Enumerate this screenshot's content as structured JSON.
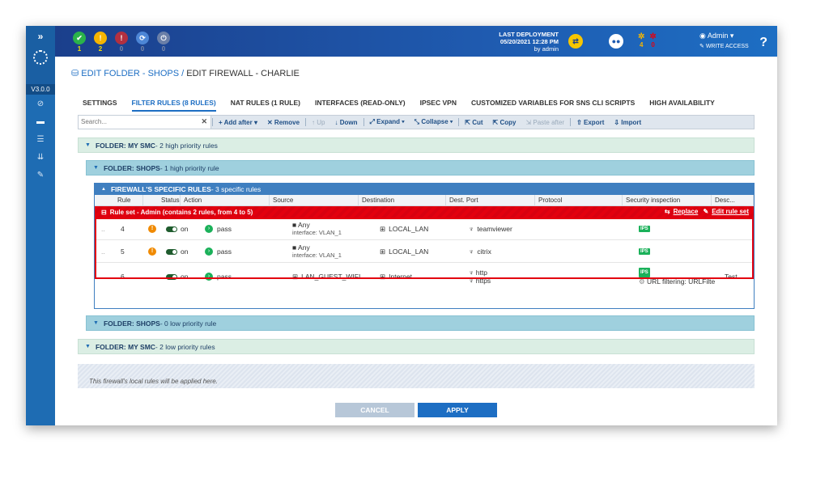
{
  "sidebar": {
    "version": "V3.0.0",
    "expand": "»"
  },
  "header": {
    "status": [
      {
        "icon": "check-icon",
        "count": "1",
        "color": "#2bb34a",
        "count_color": "#f7e000",
        "glyph": "✔"
      },
      {
        "icon": "warning-icon",
        "count": "2",
        "color": "#f7b500",
        "count_color": "#f7e000",
        "glyph": "!"
      },
      {
        "icon": "error-icon",
        "count": "0",
        "color": "#b33040",
        "count_color": "#7d8aa8",
        "glyph": "!"
      },
      {
        "icon": "sync-icon",
        "count": "0",
        "color": "#4d86d6",
        "count_color": "#7d8aa8",
        "glyph": "⟳"
      },
      {
        "icon": "power-icon",
        "count": "0",
        "color": "#6a7fa8",
        "count_color": "#7d8aa8",
        "glyph": "⏻"
      }
    ],
    "deployment": {
      "label": "LAST DEPLOYMENT",
      "date": "05/20/2021 12:28 PM",
      "by": "by admin"
    },
    "alerts": [
      {
        "icon": "maintenance-icon",
        "count": "4",
        "color": "#f7b500"
      },
      {
        "icon": "alarm-icon",
        "count": "0",
        "color": "#e3000f"
      }
    ],
    "admin": {
      "name": "Admin",
      "access": "WRITE ACCESS"
    },
    "help": "?"
  },
  "breadcrumb": {
    "path": "EDIT FOLDER - SHOPS /",
    "current": "EDIT FIREWALL - CHARLIE"
  },
  "tabs": [
    "SETTINGS",
    "FILTER RULES (8 RULES)",
    "NAT RULES (1 RULE)",
    "INTERFACES (READ-ONLY)",
    "IPSEC VPN",
    "CUSTOMIZED VARIABLES FOR SNS CLI SCRIPTS",
    "HIGH AVAILABILITY"
  ],
  "toolbar": {
    "search_placeholder": "Search...",
    "add_after": "Add after",
    "remove": "Remove",
    "up": "Up",
    "down": "Down",
    "expand": "Expand",
    "collapse": "Collapse",
    "cut": "Cut",
    "copy": "Copy",
    "paste_after": "Paste after",
    "export": "Export",
    "import": "Import"
  },
  "folders": {
    "f1": {
      "name": "FOLDER: MY SMC",
      "desc": " - 2 high priority rules"
    },
    "f2": {
      "name": "FOLDER: SHOPS",
      "desc": " - 1 high priority rule"
    },
    "f3": {
      "name": "FOLDER: SHOPS",
      "desc": " - 0 low priority rule"
    },
    "f4": {
      "name": "FOLDER: MY SMC",
      "desc": " - 2 low priority rules"
    }
  },
  "specific": {
    "title": "FIREWALL'S SPECIFIC RULES",
    "desc": " - 3 specific rules",
    "columns": [
      "Rule",
      "Status",
      "Action",
      "Source",
      "Destination",
      "Dest. Port",
      "Protocol",
      "Security inspection",
      "Desc..."
    ],
    "ruleset": {
      "label": "Rule set - Admin (contains 2 rules, from 4 to 5)",
      "replace": "Replace",
      "edit": "Edit rule set"
    },
    "rows": [
      {
        "rule": "4",
        "status": "on",
        "action": "pass",
        "source": "Any",
        "source_sub": "interface: VLAN_1",
        "destination": "LOCAL_LAN",
        "port1": "teamviewer",
        "port2": "",
        "ips": "IPS",
        "url": "",
        "desc": ""
      },
      {
        "rule": "5",
        "status": "on",
        "action": "pass",
        "source": "Any",
        "source_sub": "interface: VLAN_1",
        "destination": "LOCAL_LAN",
        "port1": "citrix",
        "port2": "",
        "ips": "IPS",
        "url": "",
        "desc": ""
      },
      {
        "rule": "6",
        "status": "on",
        "action": "pass",
        "source": "LAN_GUEST_WIFI",
        "source_sub": "",
        "destination": "Internet",
        "port1": "http",
        "port2": "https",
        "ips": "IPS",
        "url": "URL filtering: URLFilte",
        "desc": "Test ..."
      }
    ]
  },
  "local": "This firewall's local rules will be applied here.",
  "footer": {
    "cancel": "CANCEL",
    "apply": "APPLY"
  }
}
